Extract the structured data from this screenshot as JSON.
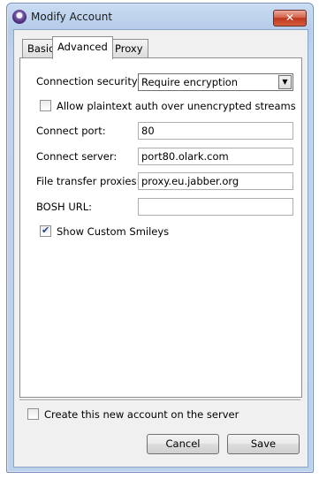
{
  "window": {
    "title": "Modify Account"
  },
  "tabs": [
    {
      "label": "Basic"
    },
    {
      "label": "Advanced"
    },
    {
      "label": "Proxy"
    }
  ],
  "advanced": {
    "connection_security": {
      "label": "Connection security:",
      "value": "Require encryption"
    },
    "allow_plaintext": {
      "label": "Allow plaintext auth over unencrypted streams",
      "checked": false
    },
    "connect_port": {
      "label": "Connect port:",
      "value": "80"
    },
    "connect_server": {
      "label": "Connect server:",
      "value": "port80.olark.com"
    },
    "file_transfer_proxies": {
      "label": "File transfer proxies:",
      "value": "proxy.eu.jabber.org"
    },
    "bosh_url": {
      "label": "BOSH URL:",
      "value": ""
    },
    "show_custom_smileys": {
      "label": "Show Custom Smileys",
      "checked": true
    }
  },
  "footer": {
    "create_account": {
      "label": "Create this new account on the server",
      "checked": false
    },
    "cancel_label": "Cancel",
    "save_label": "Save"
  },
  "icons": {
    "app": "pidgin-icon",
    "close": "close-icon"
  }
}
